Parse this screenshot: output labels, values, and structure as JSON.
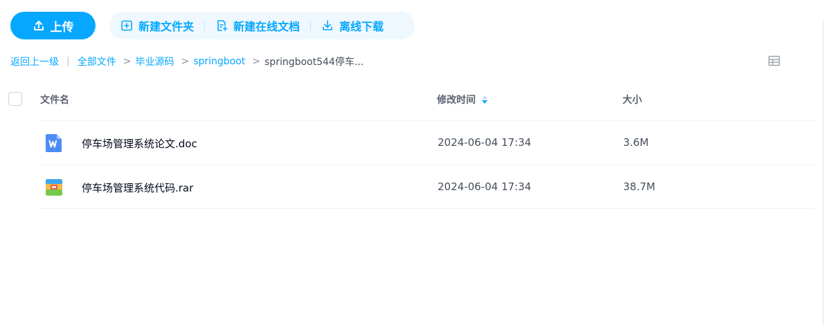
{
  "toolbar": {
    "upload_label": "上传",
    "new_folder_label": "新建文件夹",
    "new_online_doc_label": "新建在线文档",
    "offline_download_label": "离线下载"
  },
  "breadcrumb": {
    "back": "返回上一级",
    "separator": "|",
    "arrow": ">",
    "items": [
      "全部文件",
      "毕业源码",
      "springboot"
    ],
    "current": "springboot544停车..."
  },
  "table": {
    "columns": {
      "name": "文件名",
      "modified": "修改时间",
      "size": "大小"
    },
    "rows": [
      {
        "name": "停车场管理系统论文.doc",
        "modified": "2024-06-04 17:34",
        "size": "3.6M",
        "icon": "word-doc-icon"
      },
      {
        "name": "停车场管理系统代码.rar",
        "modified": "2024-06-04 17:34",
        "size": "38.7M",
        "icon": "rar-archive-icon"
      }
    ]
  },
  "colors": {
    "accent": "#06a7ff",
    "action_bg": "#eef8fe",
    "text_primary": "#03081a",
    "text_secondary": "#454d5a",
    "divider": "#f1f2f4"
  }
}
